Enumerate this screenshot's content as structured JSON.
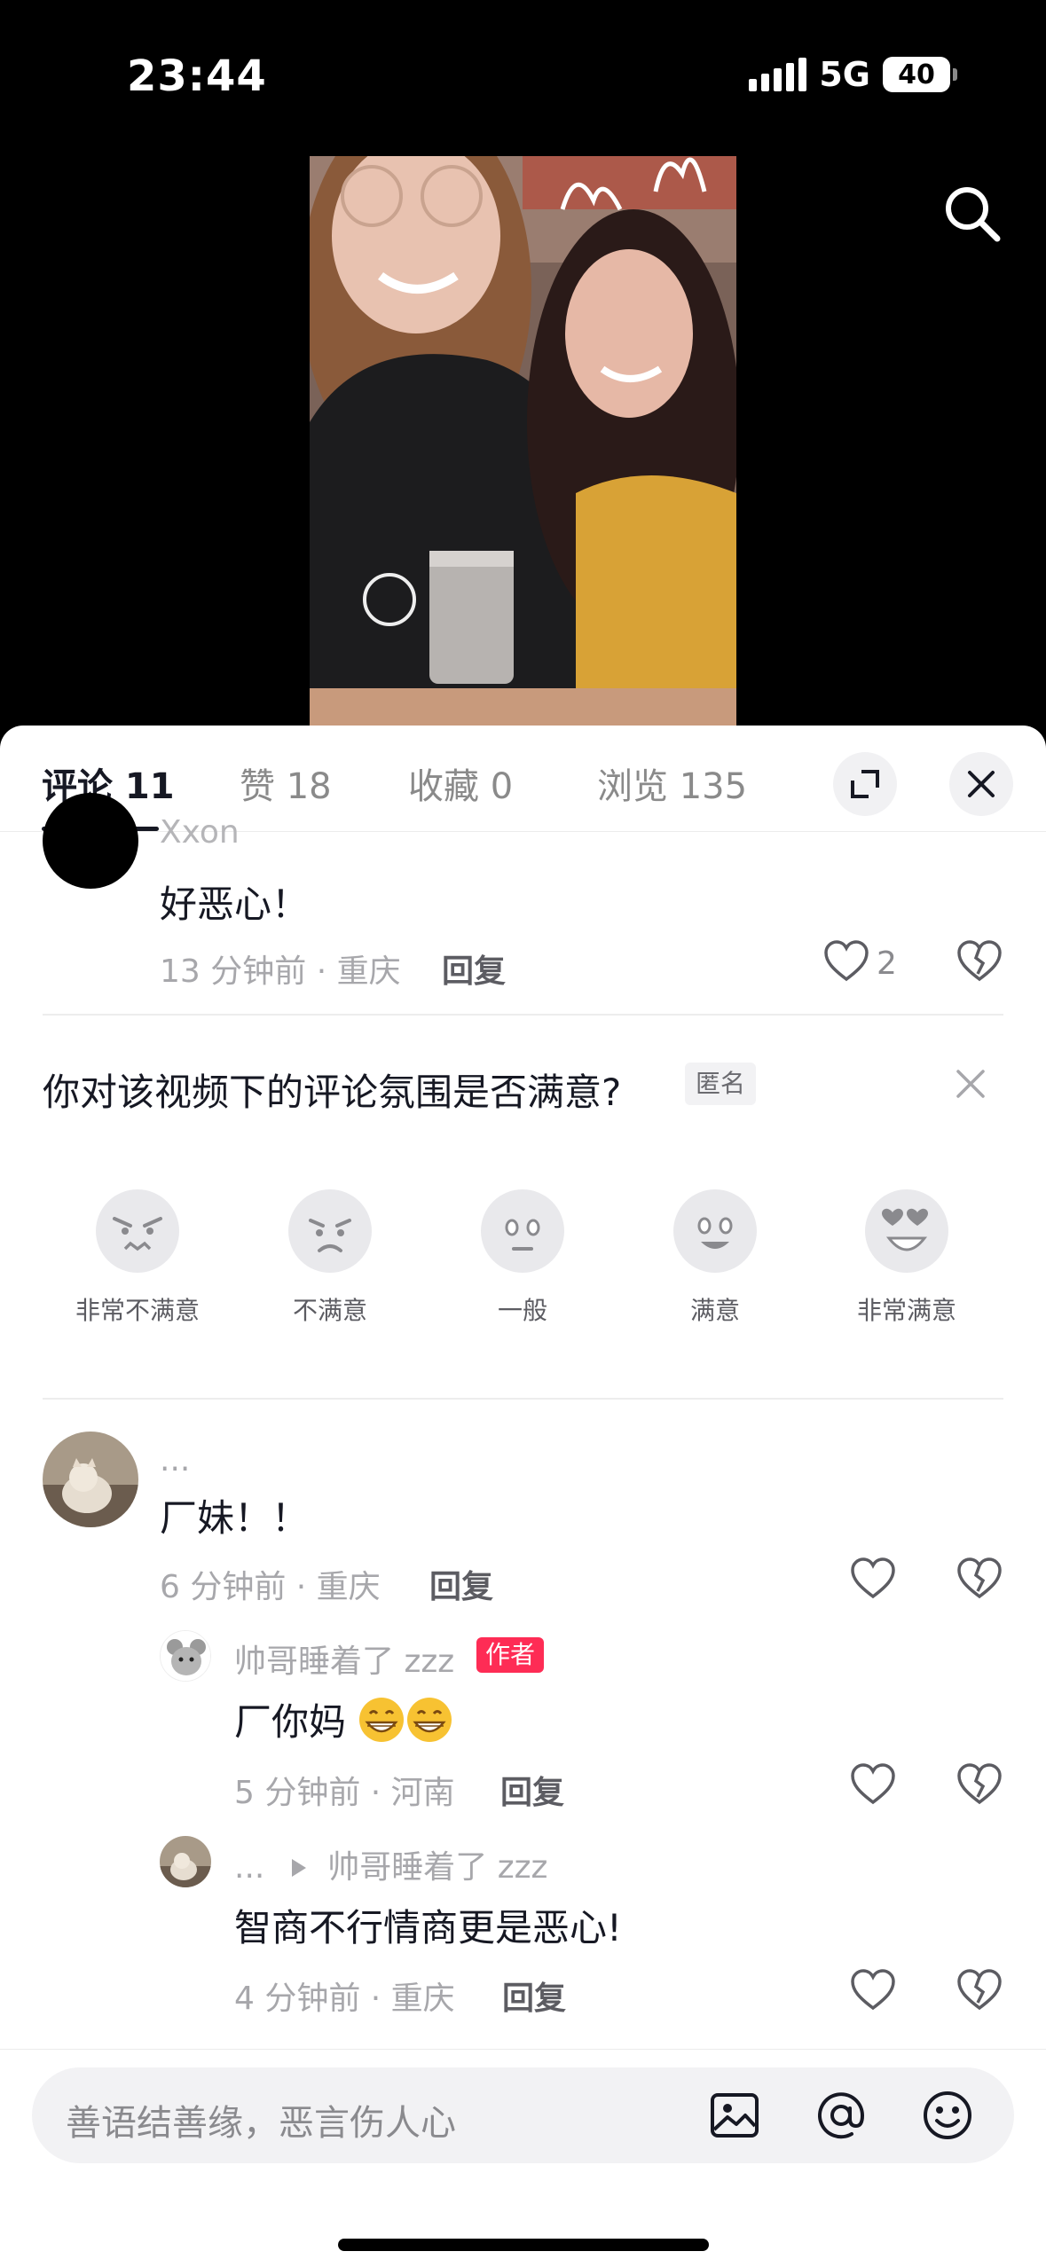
{
  "status_bar": {
    "time": "23:44",
    "network": "5G",
    "battery": "40"
  },
  "tabs": [
    {
      "label": "评论 11",
      "active": true
    },
    {
      "label": "赞 18"
    },
    {
      "label": "收藏 0"
    },
    {
      "label": "浏览 135"
    }
  ],
  "comments": {
    "c1": {
      "username": "Xxon",
      "text": "好恶心！",
      "meta": "13 分钟前 · 重庆",
      "reply": "回复",
      "likes": "2"
    },
    "survey": {
      "question": "你对该视频下的评论氛围是否满意?",
      "anonymous": "匿名",
      "options": [
        "非常不满意",
        "不满意",
        "一般",
        "满意",
        "非常满意"
      ]
    },
    "c2": {
      "username": "...",
      "text": "厂妹！！",
      "meta": "6 分钟前 · 重庆",
      "reply": "回复"
    },
    "c2_reply1": {
      "username": "帅哥睡着了 zzz",
      "badge": "作者",
      "text": "厂你妈",
      "meta": "5 分钟前 · 河南",
      "reply": "回复"
    },
    "c2_reply2": {
      "username": "...",
      "reply_to": "帅哥睡着了 zzz",
      "text": "智商不行情商更是恶心!",
      "meta": "4 分钟前 · 重庆",
      "reply": "回复"
    }
  },
  "input": {
    "placeholder": "善语结善缘，恶言伤人心"
  }
}
